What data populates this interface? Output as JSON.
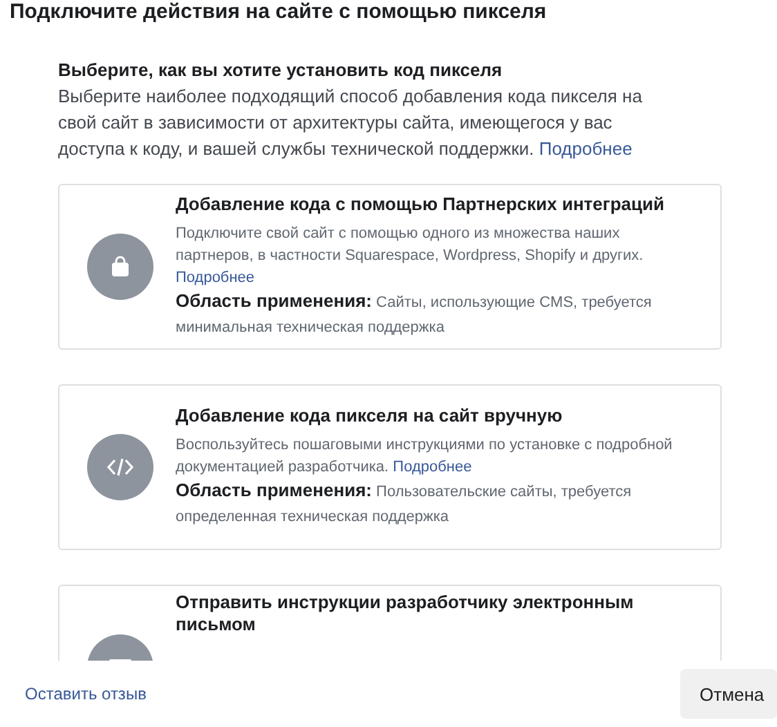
{
  "title": "Подключите действия на сайте с помощью пикселя",
  "intro": {
    "heading": "Выберите, как вы хотите установить код пикселя",
    "text": "Выберите наиболее подходящий способ добавления кода пикселя на свой сайт в зависимости от архитектуры сайта, имеющегося у вас доступа к коду, и вашей службы технической поддержки.",
    "link": "Подробнее"
  },
  "options": [
    {
      "kind": "bag",
      "title": "Добавление кода с помощью Партнерских интеграций",
      "text": "Подключите свой сайт с помощью одного из множества наших партнеров, в частности Squarespace, Wordpress, Shopify и других.",
      "link": "Подробнее",
      "scope_label": "Область применения:",
      "scope": "Сайты, использующие CMS, требуется минимальная техническая поддержка"
    },
    {
      "kind": "code",
      "title": "Добавление кода пикселя на сайт вручную",
      "text": "Воспользуйтесь пошаговыми инструкциями по установке с подробной документацией разработчика.",
      "link": "Подробнее",
      "scope_label": "Область применения:",
      "scope": "Пользовательские сайты, требуется определенная техническая поддержка"
    },
    {
      "kind": "mail",
      "title": "Отправить инструкции разработчику электронным письмом"
    }
  ],
  "footer": {
    "feedback_link": "Оставить отзыв",
    "cancel_button": "Отмена"
  }
}
